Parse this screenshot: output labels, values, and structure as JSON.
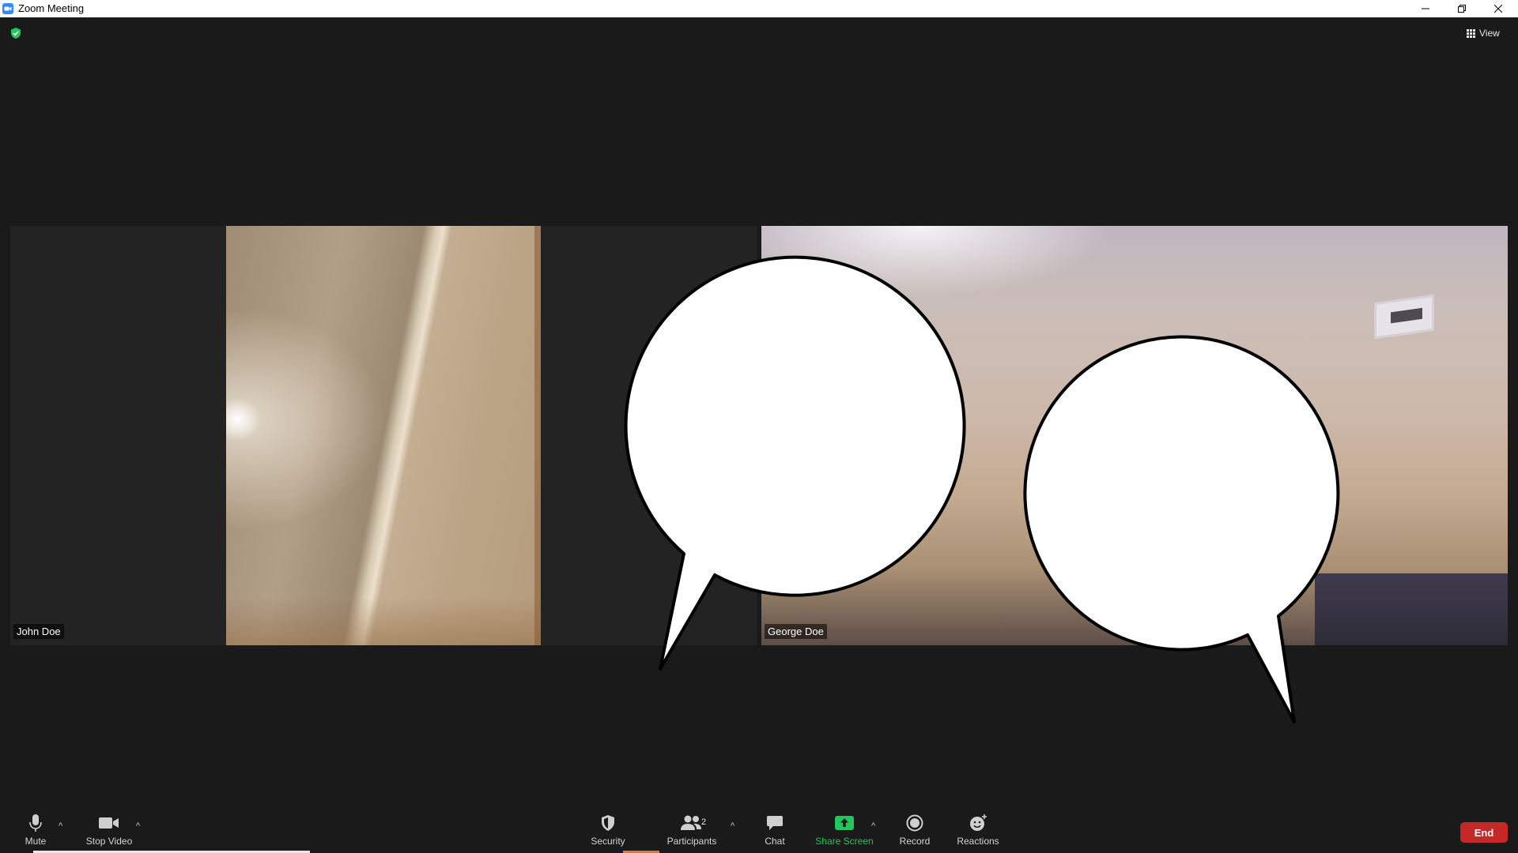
{
  "window": {
    "title": "Zoom Meeting"
  },
  "meeting": {
    "view_label": "View",
    "participants": [
      {
        "name": "John Doe"
      },
      {
        "name": "George Doe"
      }
    ]
  },
  "toolbar": {
    "mute_label": "Mute",
    "stop_video_label": "Stop Video",
    "security_label": "Security",
    "participants_label": "Participants",
    "participants_count": "2",
    "chat_label": "Chat",
    "share_screen_label": "Share Screen",
    "record_label": "Record",
    "reactions_label": "Reactions",
    "end_label": "End"
  },
  "colors": {
    "background": "#1a1a1a",
    "share_green": "#22c55e",
    "end_red": "#c62828",
    "encryption_green": "#22c55e"
  },
  "icons": [
    "zoom-app-icon",
    "minimize-icon",
    "restore-icon",
    "close-icon",
    "encryption-shield-icon",
    "grid-view-icon",
    "microphone-icon",
    "camera-icon",
    "security-shield-icon",
    "participants-icon",
    "chat-bubble-icon",
    "share-screen-arrow-icon",
    "record-icon",
    "reactions-smiley-icon",
    "speech-bubble"
  ]
}
